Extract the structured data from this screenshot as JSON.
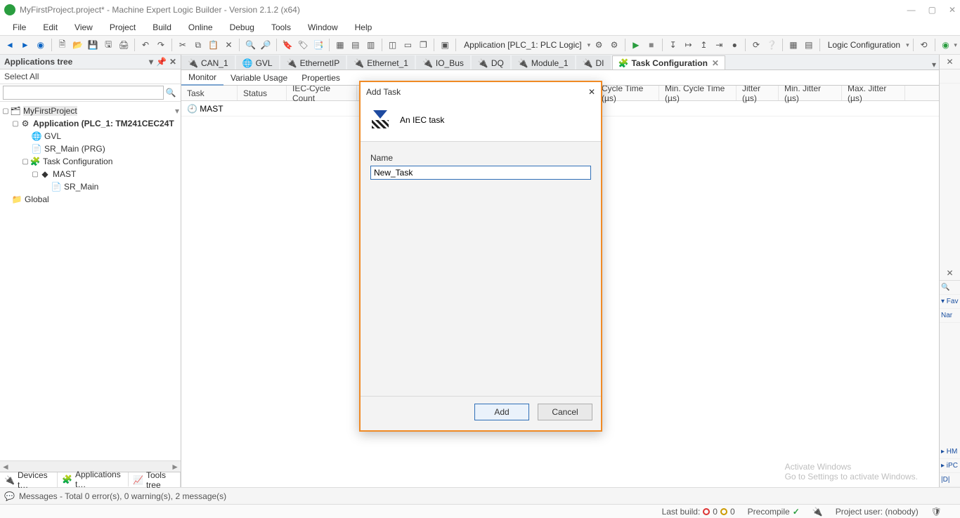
{
  "window": {
    "title": "MyFirstProject.project* - Machine Expert Logic Builder - Version 2.1.2 (x64)"
  },
  "menu": {
    "items": [
      "File",
      "Edit",
      "View",
      "Project",
      "Build",
      "Online",
      "Debug",
      "Tools",
      "Window",
      "Help"
    ]
  },
  "toolbar": {
    "context": "Application [PLC_1: PLC Logic]",
    "config": "Logic Configuration"
  },
  "appsTree": {
    "title": "Applications tree",
    "selectAll": "Select All",
    "searchPlaceholder": "",
    "nodes": {
      "project": "MyFirstProject",
      "application": "Application (PLC_1: TM241CEC24T",
      "gvl": "GVL",
      "sr_main_prg": "SR_Main (PRG)",
      "task_cfg": "Task Configuration",
      "mast": "MAST",
      "sr_main": "SR_Main",
      "global": "Global"
    },
    "bottomTabs": {
      "devices": "Devices t…",
      "apps": "Applications t…",
      "tools": "Tools tree"
    }
  },
  "docTabs": {
    "items": [
      "CAN_1",
      "GVL",
      "EthernetIP",
      "Ethernet_1",
      "IO_Bus",
      "DQ",
      "Module_1",
      "DI",
      "Task Configuration"
    ],
    "activeIndex": 8
  },
  "subTabs": {
    "items": [
      "Monitor",
      "Variable Usage",
      "Properties"
    ],
    "activeIndex": 0
  },
  "grid": {
    "headers": [
      "Task",
      "Status",
      "IEC-Cycle Count",
      "Cycle Time (µs)",
      "Min. Cycle Time (µs)",
      "Jitter (µs)",
      "Min. Jitter (µs)",
      "Max. Jitter (µs)"
    ],
    "rows": [
      {
        "task": "MAST"
      }
    ]
  },
  "rightStrip": {
    "items": [
      "✕",
      "🔍",
      "▾ Fav",
      "Nar",
      "▸ HM",
      "▸ iPC",
      "|D|"
    ]
  },
  "dialog": {
    "title": "Add Task",
    "subtitle": "An IEC task",
    "nameLabel": "Name",
    "nameValue": "New_Task",
    "add": "Add",
    "cancel": "Cancel"
  },
  "messages": {
    "text": "Messages - Total 0 error(s), 0 warning(s), 2 message(s)"
  },
  "status": {
    "lastBuild": "Last build:",
    "err": "0",
    "warn": "0",
    "precompile": "Precompile",
    "projectUser": "Project user: (nobody)"
  },
  "watermark": {
    "line1": "Activate Windows",
    "line2": "Go to Settings to activate Windows."
  }
}
